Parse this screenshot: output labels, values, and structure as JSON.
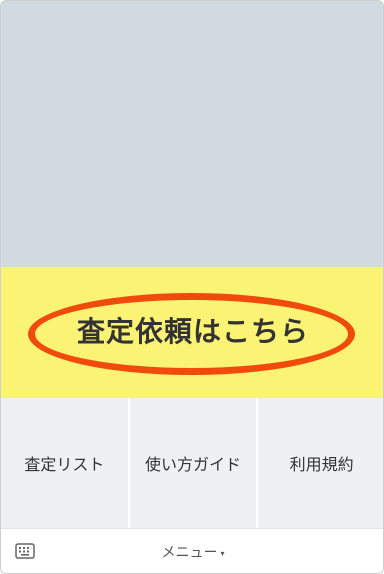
{
  "banner": {
    "text": "査定依頼はこちら",
    "background": "#fbf374",
    "ellipse_color": "#f04a0c"
  },
  "menu": {
    "items": [
      {
        "label": "査定リスト"
      },
      {
        "label": "使い方ガイド"
      },
      {
        "label": "利用規約"
      }
    ]
  },
  "bottom_bar": {
    "toggle_label": "メニュー",
    "caret": "▾",
    "keyboard_icon": "keyboard-icon"
  }
}
